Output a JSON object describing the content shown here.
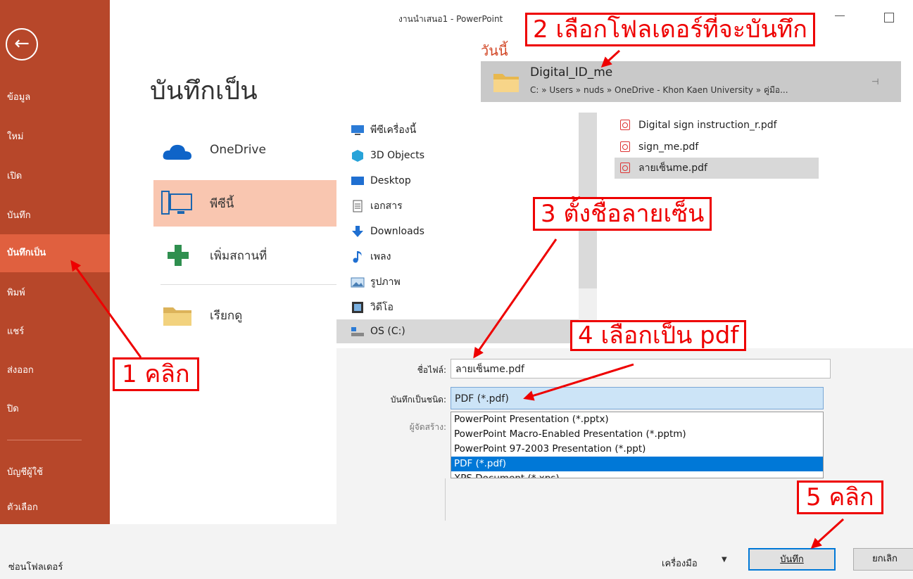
{
  "window": {
    "title": "งานนำเสนอ1 - PowerPoint"
  },
  "backstage": {
    "nav": [
      {
        "label": "ข้อมูล"
      },
      {
        "label": "ใหม่"
      },
      {
        "label": "เปิด"
      },
      {
        "label": "บันทึก"
      },
      {
        "label": "บันทึกเป็น",
        "selected": true
      },
      {
        "label": "พิมพ์"
      },
      {
        "label": "แชร์"
      },
      {
        "label": "ส่งออก"
      },
      {
        "label": "ปิด"
      },
      {
        "label": "บัญชีผู้ใช้"
      },
      {
        "label": "ตัวเลือก"
      }
    ],
    "heading": "บันทึกเป็น",
    "locations": [
      {
        "label": "OneDrive",
        "icon": "cloud-icon"
      },
      {
        "label": "พีซีนี้",
        "icon": "computer-icon",
        "selected": true
      },
      {
        "label": "เพิ่มสถานที่",
        "icon": "plus-icon"
      },
      {
        "label": "เรียกดู",
        "icon": "folder-icon"
      }
    ],
    "accent_color": "#b7472a"
  },
  "dialog": {
    "today_label": "วันนี้",
    "recent_folder": {
      "name": "Digital_ID_me",
      "path": "C: » Users » nuds » OneDrive - Khon Kaen University » คู่มือ..."
    },
    "tree": [
      {
        "label": "พีซีเครื่องนี้",
        "icon": "this-pc-icon"
      },
      {
        "label": "3D Objects",
        "icon": "3d-objects-icon"
      },
      {
        "label": "Desktop",
        "icon": "desktop-icon"
      },
      {
        "label": "เอกสาร",
        "icon": "documents-icon"
      },
      {
        "label": "Downloads",
        "icon": "downloads-icon"
      },
      {
        "label": "เพลง",
        "icon": "music-icon"
      },
      {
        "label": "รูปภาพ",
        "icon": "pictures-icon"
      },
      {
        "label": "วิดีโอ",
        "icon": "videos-icon"
      },
      {
        "label": "OS (C:)",
        "icon": "drive-icon",
        "selected": true
      }
    ],
    "files": [
      {
        "label": "Digital sign instruction_r.pdf"
      },
      {
        "label": "sign_me.pdf"
      },
      {
        "label": "ลายเซ็นme.pdf",
        "selected": true
      }
    ],
    "filename_label": "ชื่อไฟล์:",
    "filename_value": "ลายเซ็นme.pdf",
    "filetype_label": "บันทึกเป็นชนิด:",
    "filetype_value": "PDF (*.pdf)",
    "author_label": "ผู้จัดสร้าง:",
    "filetype_options": [
      {
        "label": "PowerPoint Presentation (*.pptx)"
      },
      {
        "label": "PowerPoint Macro-Enabled Presentation (*.pptm)"
      },
      {
        "label": "PowerPoint 97-2003 Presentation (*.ppt)"
      },
      {
        "label": "PDF (*.pdf)",
        "selected": true
      },
      {
        "label": "XPS Document (*.xps)"
      }
    ],
    "hide_folders": "ซ่อนโฟลเดอร์",
    "tools_label": "เครื่องมือ",
    "save_label": "บันทึก",
    "cancel_label": "ยกเลิก",
    "help_glyph": "?"
  },
  "annotations": {
    "step1": "1 คลิก",
    "step2": "2 เลือกโฟลเดอร์ที่จะบันทึก",
    "step3": "3 ตั้งชื่อลายเซ็น",
    "step4": "4 เลือกเป็น pdf",
    "step5": "5 คลิก",
    "color": "#e00000"
  }
}
